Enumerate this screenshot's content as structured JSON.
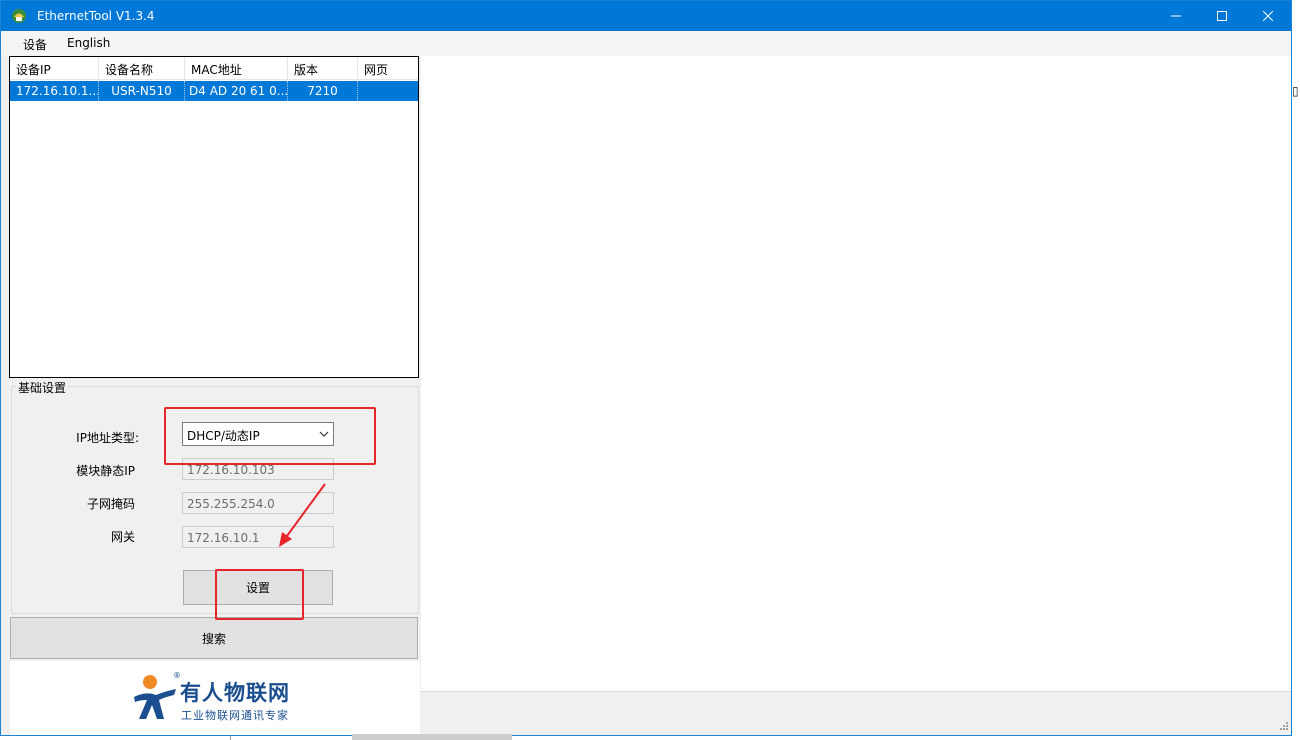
{
  "window": {
    "title": "EthernetTool V1.3.4"
  },
  "menu": {
    "device": "设备",
    "english": "English"
  },
  "device_table": {
    "columns": [
      "设备IP",
      "设备名称",
      "MAC地址",
      "版本",
      "网页"
    ],
    "rows": [
      {
        "ip": "172.16.10.1...",
        "name": "USR-N510",
        "mac": "D4 AD 20 61 0...",
        "version": "7210",
        "web": ""
      }
    ]
  },
  "basic_settings": {
    "title": "基础设置",
    "ip_type_label": "IP地址类型:",
    "ip_type_value": "DHCP/动态IP",
    "static_ip_label": "模块静态IP",
    "static_ip_value": "172.16.10.103",
    "mask_label": "子网掩码",
    "mask_value": "255.255.254.0",
    "gateway_label": "网关",
    "gateway_value": "172.16.10.1",
    "set_button": "设置"
  },
  "search_button": "搜索",
  "logo": {
    "main": "有人物联网",
    "sub": "工业物联网通讯专家",
    "reg": "®"
  },
  "colors": {
    "titlebar": "#0078d7",
    "selection": "#0078d7",
    "annotation": "#e8242b",
    "logo_blue": "#1b4e8f",
    "logo_orange": "#f08a24"
  }
}
